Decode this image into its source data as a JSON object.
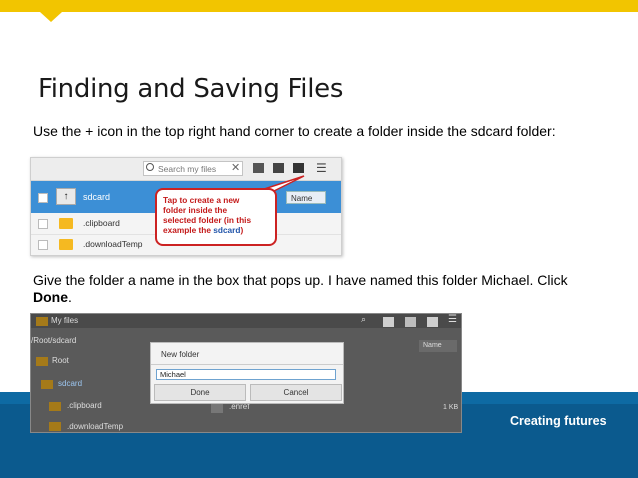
{
  "slide": {
    "title": "Finding and Saving Files",
    "paragraph1": "Use the + icon in the top right hand corner to create a folder inside the sdcard folder:",
    "paragraph2_pre": "Give the folder a name in the box that pops up. I have named this folder Michael. Click ",
    "paragraph2_bold": "Done",
    "paragraph2_post": ".",
    "footer_tagline": "Creating futures"
  },
  "screenshot1": {
    "search_placeholder": "Search my files",
    "header_folder": "sdcard",
    "sort_label": "Name",
    "rows": [
      ".clipboard",
      ".downloadTemp"
    ],
    "callout_line1": "Tap to create a new",
    "callout_line2": "folder inside the",
    "callout_line3": "selected folder (in this",
    "callout_line4a": "example the ",
    "callout_line4b": "sdcard",
    "callout_line4c": ")"
  },
  "screenshot2": {
    "app_title": "My files",
    "path": "/Root/sdcard",
    "sidebar": [
      "Root",
      "sdcard",
      ".clipboard",
      ".downloadTemp"
    ],
    "sort_label": "Name",
    "row_label": ".enref",
    "row_size": "1 KB",
    "dialog": {
      "title": "New folder",
      "input_value": "Michael",
      "done_label": "Done",
      "cancel_label": "Cancel"
    }
  },
  "colors": {
    "accent_yellow": "#f2c500",
    "footer_blue": "#0b5a8e",
    "header_blue": "#3c8fd6",
    "callout_red": "#cc2222"
  }
}
